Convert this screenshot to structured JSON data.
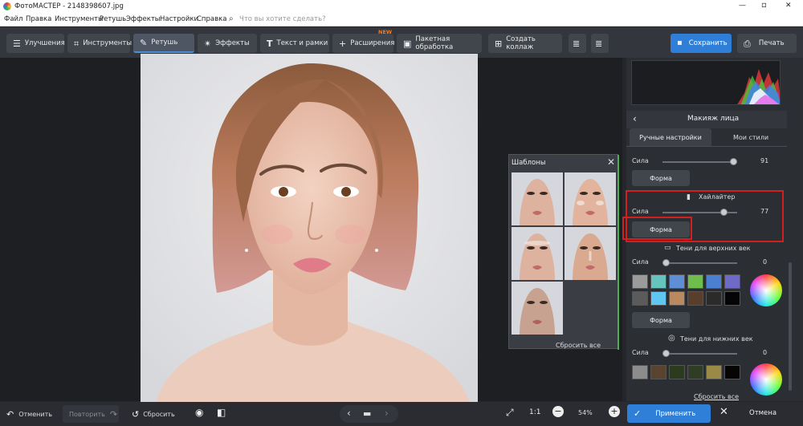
{
  "window": {
    "title": "ФотоМАСТЕР - 2148398607.jpg",
    "controls": [
      "—",
      "▫",
      "✕"
    ]
  },
  "menu": {
    "items": [
      "Файл",
      "Правка",
      "Инструменты",
      "Ретушь",
      "Эффекты",
      "Настройки",
      "Справка"
    ],
    "search_placeholder": "Что вы хотите сделать?"
  },
  "toolbar": {
    "tabs": [
      {
        "label": "Улучшения",
        "icon": "sliders-icon"
      },
      {
        "label": "Инструменты",
        "icon": "crop-icon"
      },
      {
        "label": "Ретушь",
        "icon": "brush-icon",
        "active": true
      },
      {
        "label": "Эффекты",
        "icon": "sparkle-icon"
      },
      {
        "label": "Текст и рамки",
        "icon": "text-icon"
      },
      {
        "label": "Расширения",
        "icon": "plus-icon",
        "badge": "NEW"
      },
      {
        "label": "Пакетная обработка",
        "icon": "images-icon"
      },
      {
        "label": "Создать коллаж",
        "icon": "collage-icon"
      }
    ],
    "save_label": "Сохранить",
    "print_label": "Печать"
  },
  "templates": {
    "title": "Шаблоны",
    "reset_label": "Сбросить все"
  },
  "panel": {
    "title": "Макияж лица",
    "tabs": [
      "Ручные настройки",
      "Мои стили"
    ],
    "sections": [
      {
        "label": "",
        "strength_label": "Сила",
        "value": "91",
        "level": 0.91,
        "button": "Форма"
      },
      {
        "label": "Хайлайтер",
        "strength_label": "Сила",
        "value": "77",
        "level": 0.77,
        "button": "Форма"
      },
      {
        "label": "Тени для верхних век",
        "strength_label": "Сила",
        "value": "0",
        "level": 0,
        "button": "Форма"
      },
      {
        "label": "Тени для нижних век",
        "strength_label": "Сила",
        "value": "0",
        "level": 0
      }
    ],
    "upper_swatches": [
      "#9b9b9b",
      "#67c4bd",
      "#5f8ed6",
      "#6fbd4d",
      "#4a7fd1",
      "#6e6ac5",
      "#5b5b5b",
      "#5fc7f2",
      "#b98a5f",
      "#5a3e2c",
      "#2b2b2b",
      "#050505"
    ],
    "lower_swatches": [
      "#8c8c8c",
      "#5a4430",
      "#2c3a1e",
      "#2f3d24",
      "#9a8a45",
      "#050505"
    ],
    "reset_all": "Сбросить все",
    "apply_label": "Применить",
    "cancel_label": "Отмена"
  },
  "bottom": {
    "undo_label": "Отменить",
    "redo_label": "Повторить",
    "reset_label": "Сбросить",
    "zoom_ratio": "1:1",
    "zoom_percent": "54%"
  }
}
